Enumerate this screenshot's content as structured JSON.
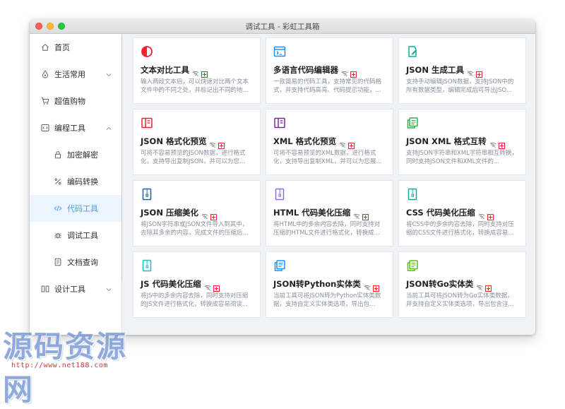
{
  "window": {
    "title": "调试工具 - 彩虹工具箱"
  },
  "sidebar": {
    "items": [
      {
        "label": "首页",
        "icon": "home-icon"
      },
      {
        "label": "生活常用",
        "icon": "drop-icon"
      },
      {
        "label": "超值购物",
        "icon": "cart-icon"
      },
      {
        "label": "编程工具",
        "icon": "code-box-icon"
      },
      {
        "label": "加密解密",
        "icon": "lock-icon"
      },
      {
        "label": "编码转换",
        "icon": "percent-icon"
      },
      {
        "label": "代码工具",
        "icon": "code-icon"
      },
      {
        "label": "调试工具",
        "icon": "bug-icon"
      },
      {
        "label": "文档查询",
        "icon": "doc-icon"
      },
      {
        "label": "设计工具",
        "icon": "design-icon"
      }
    ]
  },
  "cards": [
    {
      "title": "文本对比工具",
      "desc": "输入两段文本后，可以快速对比两个文本文件中的不同之处，并标记出不同的地...",
      "icon": "half-circle-icon",
      "color": "#f5222d"
    },
    {
      "title": "多语言代码编辑器",
      "desc": "一款简易的代码工具，支持常见的代码格式，并支持代码高亮、代码提示功能，...",
      "icon": "code-window-icon",
      "color": "#1890ff"
    },
    {
      "title": "JSON 生成工具",
      "desc": "支持手动编辑JSON数据，支持JSON中的所有数据类型，编辑完成后可导出JSO...",
      "icon": "file-edit-icon",
      "color": "#13a89e"
    },
    {
      "title": "JSON 格式化预览",
      "desc": "可将不容易预览的JSON数据，进行格式化，支持导出复制JSON，并可以为您...",
      "icon": "book-icon",
      "color": "#f5222d"
    },
    {
      "title": "XML 格式化预览",
      "desc": "可将不容易预览的XML数据，进行格式化，支持导出复制XML，并可以为您展...",
      "icon": "book-icon",
      "color": "#7b2d8e"
    },
    {
      "title": "JSON XML 格式互转",
      "desc": "支持JSON字符串和XML字符串相互转换，同时支持JSON文件和XML文件的...",
      "icon": "copy-doc-icon",
      "color": "#28b446"
    },
    {
      "title": "JSON 压缩美化",
      "desc": "将JSON字符串或JSON文件导入到其中，去除其多余的内容，完成文件的压缩后...",
      "icon": "zip-icon",
      "color": "#1d5fa8"
    },
    {
      "title": "HTML 代码美化压缩",
      "desc": "将HTML中的多余内容去除，同时支持对压缩的HTML文件进行格式化，转换成...",
      "icon": "zip-icon",
      "color": "#8e6cd8"
    },
    {
      "title": "CSS 代码美化压缩",
      "desc": "将CSS中的多余内容去除，同时支持对压缩的CSS文件进行格式化，转换成容易...",
      "icon": "zip-icon",
      "color": "#13a89e"
    },
    {
      "title": "JS 代码美化压缩",
      "desc": "将JS中的多余内容去除，同时支持对压缩的JS文件进行格式化，转换成容易阅读...",
      "icon": "zip-icon",
      "color": "#13c2c2"
    },
    {
      "title": "JSON转Python实体类",
      "desc": "当前工具可将JSON转为Python实体类数据，支持自定义实体类选项，导出包...",
      "icon": "copy-doc-icon",
      "color": "#1890ff"
    },
    {
      "title": "JSON转Go实体类",
      "desc": "当前工具可将JSON转为Go实体类数据，并支持自定义实体类选项，导出包含注...",
      "icon": "copy-doc-icon",
      "color": "#52c41a"
    }
  ],
  "watermark": {
    "text": "源码资源网",
    "url": "http://www.net188.com"
  },
  "colors": {
    "accent": "#409eff",
    "active_bg": "#ecf5ff",
    "badge_red": "#f5222d"
  }
}
